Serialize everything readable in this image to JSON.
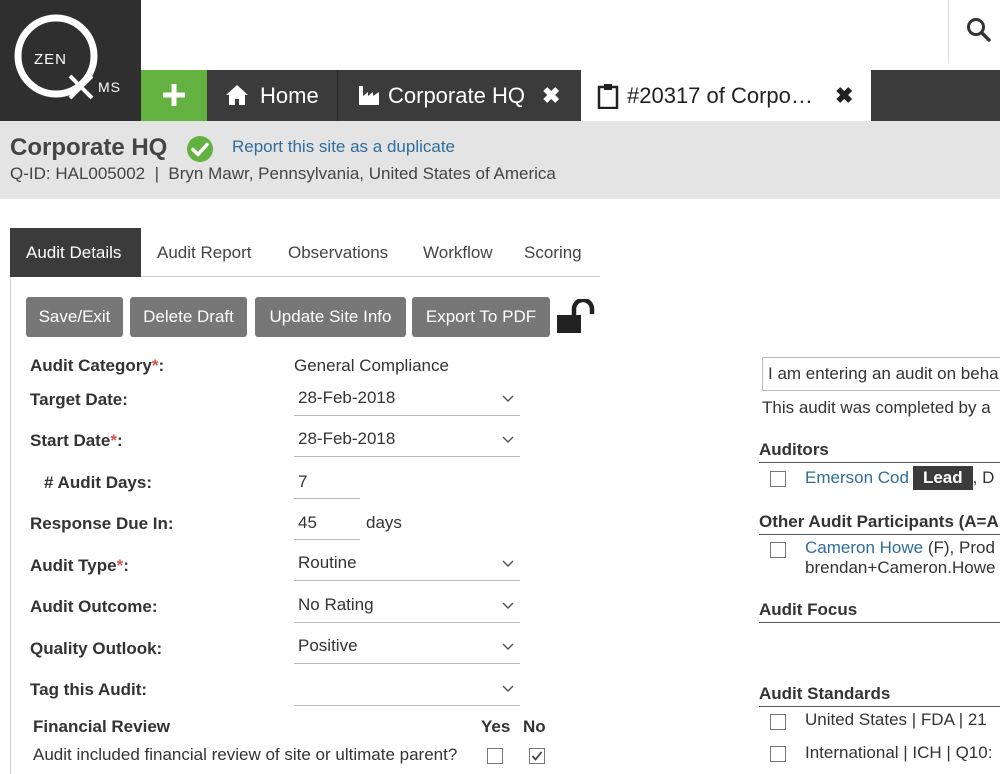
{
  "app": {
    "logo_text_top": "ZEN",
    "logo_text_bottom": "MS",
    "accent_green": "#63b140",
    "dark_bar": "#3b3b3b",
    "link_color": "#2f6d9c",
    "required_color": "#d9534f"
  },
  "tabs": {
    "home_label": "Home",
    "corp_label": "Corporate HQ",
    "audit_label": "#20317 of Corpo…",
    "close_glyph": "✖"
  },
  "site": {
    "title": "Corporate HQ",
    "duplicate_link": "Report this site as a duplicate",
    "subtitle": "Q-ID: HAL005002  |  Bryn Mawr, Pennsylvania, United States of America"
  },
  "nav": {
    "items": [
      "Audit Details",
      "Audit Report",
      "Observations",
      "Workflow",
      "Scoring"
    ]
  },
  "toolbar": {
    "save_exit": "Save/Exit",
    "delete_draft": "Delete Draft",
    "update_site_info": "Update Site Info",
    "export_pdf": "Export To PDF"
  },
  "form": {
    "audit_category_label": "Audit Category",
    "audit_category_value": "General Compliance",
    "target_date_label": "Target Date:",
    "target_date_value": "28-Feb-2018",
    "start_date_label": "Start Date",
    "start_date_value": "28-Feb-2018",
    "audit_days_label": "# Audit Days:",
    "audit_days_value": "7",
    "response_due_label": "Response Due In:",
    "response_due_value": "45",
    "response_due_unit": "days",
    "audit_type_label": "Audit Type",
    "audit_type_value": "Routine",
    "audit_outcome_label": "Audit Outcome:",
    "audit_outcome_value": "No Rating",
    "quality_outlook_label": "Quality Outlook:",
    "quality_outlook_value": "Positive",
    "tag_label": "Tag this Audit:",
    "tag_value": "",
    "required_mark": "*",
    "colon": ":",
    "financial_review_label": "Financial Review",
    "yes_label": "Yes",
    "no_label": "No",
    "financial_question": "Audit included financial review of site or ultimate parent?",
    "financial_yes_checked": false,
    "financial_no_checked": true
  },
  "right": {
    "behalf_text": "I am entering an audit on beha",
    "completed_text": "This audit was completed by a",
    "auditors_heading": "Auditors",
    "auditor_name": "Emerson Cod",
    "lead_badge": "Lead",
    "auditor_suffix": ", D",
    "participants_heading": "Other Audit Participants (A=A",
    "participant_name": "Cameron Howe",
    "participant_suffix": " (F), Prod",
    "participant_email": "brendan+Cameron.Howe",
    "focus_heading": "Audit Focus",
    "standards_heading": "Audit Standards",
    "standard_1": "United States | FDA | 21",
    "standard_2": "International | ICH | Q10:"
  }
}
